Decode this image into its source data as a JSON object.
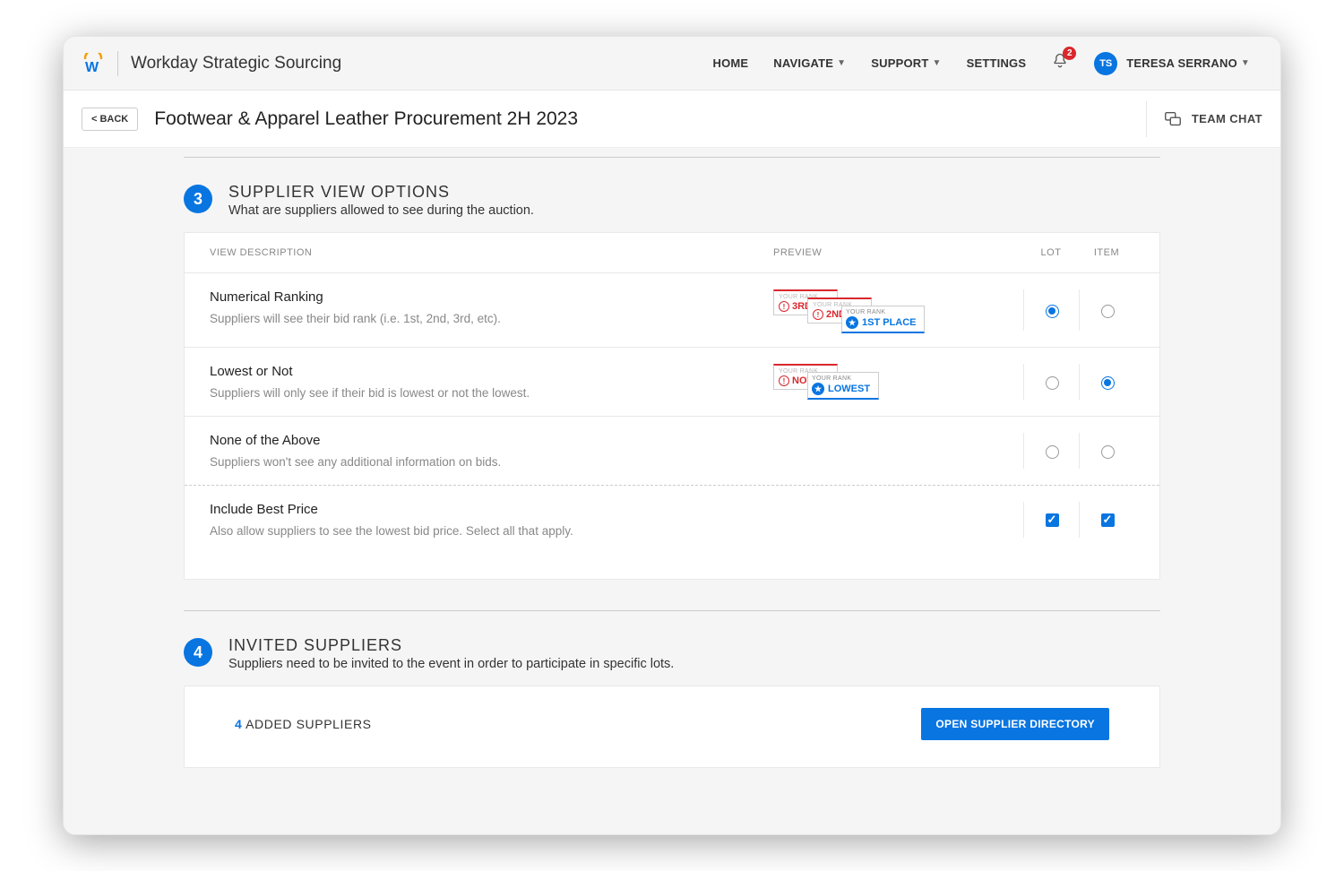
{
  "brand": "Workday Strategic Sourcing",
  "topnav": {
    "items": [
      "HOME",
      "NAVIGATE",
      "SUPPORT",
      "SETTINGS"
    ],
    "notif_count": "2",
    "user_initials": "TS",
    "user_name": "TERESA SERRANO"
  },
  "subheader": {
    "back": "< BACK",
    "title": "Footwear & Apparel Leather Procurement 2H 2023",
    "team_chat": "TEAM CHAT"
  },
  "section3": {
    "step": "3",
    "title": "SUPPLIER VIEW OPTIONS",
    "subtitle": "What are suppliers allowed to see during the auction.",
    "columns": {
      "desc": "VIEW DESCRIPTION",
      "preview": "PREVIEW",
      "lot": "LOT",
      "item": "ITEM"
    },
    "rows": [
      {
        "title": "Numerical Ranking",
        "sub": "Suppliers will see their bid rank (i.e. 1st, 2nd, 3rd, etc).",
        "preview": {
          "kind": "numerical",
          "labels": {
            "your_rank": "YOUR RANK",
            "b1": "3RD",
            "b2": "2ND",
            "b3": "1ST PLACE"
          }
        },
        "lot_selected": true,
        "item_selected": false
      },
      {
        "title": "Lowest or Not",
        "sub": "Suppliers will only see if their bid is lowest or not the lowest.",
        "preview": {
          "kind": "lowest",
          "labels": {
            "your_rank": "YOUR RANK",
            "b1": "NOT",
            "b2": "LOWEST"
          }
        },
        "lot_selected": false,
        "item_selected": true
      },
      {
        "title": "None of the Above",
        "sub": "Suppliers won't see any additional information on bids.",
        "preview": {
          "kind": "none"
        },
        "lot_selected": false,
        "item_selected": false
      },
      {
        "title": "Include Best Price",
        "sub": "Also allow suppliers to see the lowest bid price. Select all that apply.",
        "preview": {
          "kind": "none"
        },
        "lot_checked": true,
        "item_checked": true
      }
    ]
  },
  "section4": {
    "step": "4",
    "title": "INVITED SUPPLIERS",
    "subtitle": "Suppliers need to be invited to the event in order to participate in specific lots.",
    "added_count": "4",
    "added_label": "ADDED SUPPLIERS",
    "button": "OPEN SUPPLIER DIRECTORY"
  }
}
